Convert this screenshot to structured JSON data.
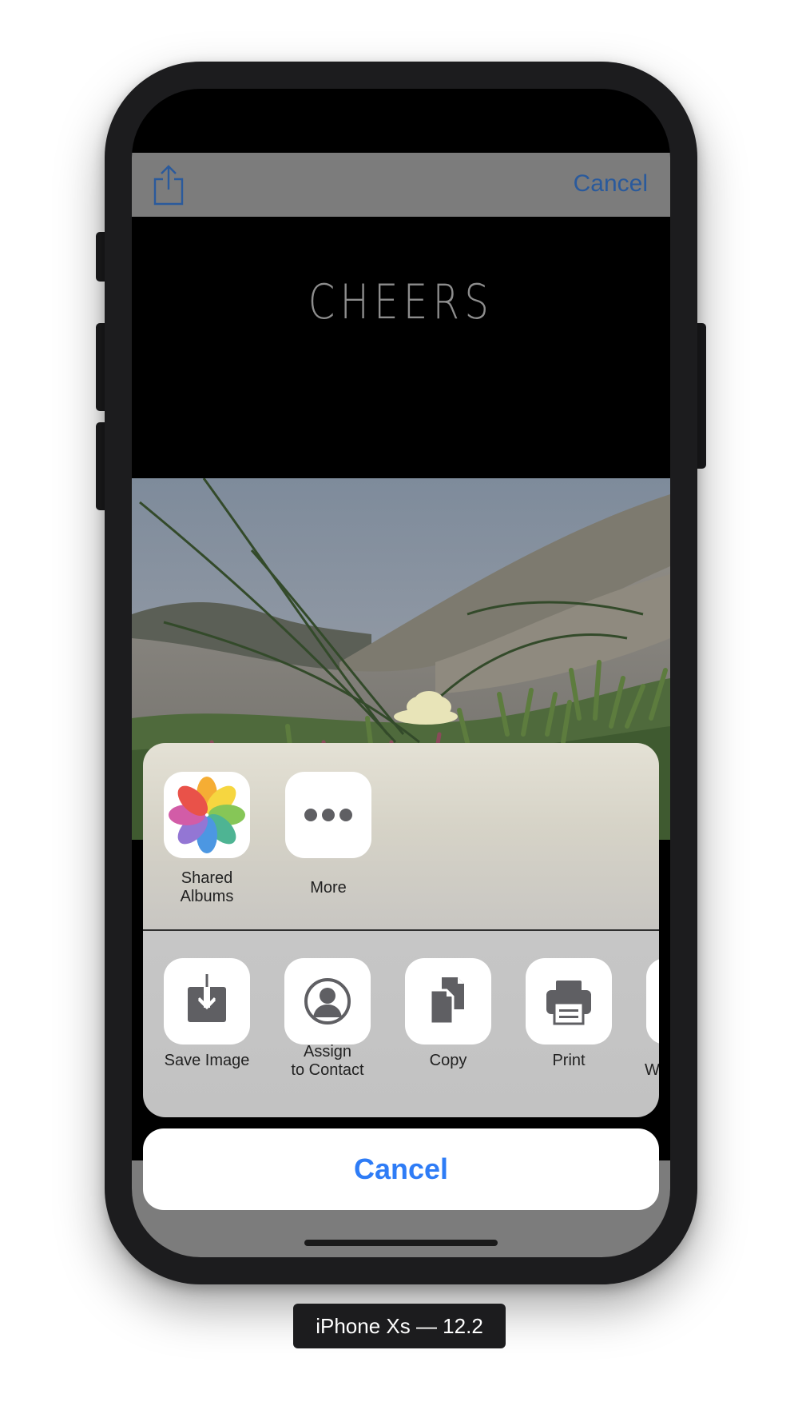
{
  "toolbar": {
    "share_icon": "share-icon",
    "cancel_label": "Cancel"
  },
  "content": {
    "title": "CHEERS"
  },
  "share_sheet": {
    "apps": [
      {
        "label": "Shared\nAlbums",
        "icon": "photos-icon"
      },
      {
        "label": "More",
        "icon": "more-icon"
      }
    ],
    "actions": [
      {
        "label": "Save Image",
        "icon": "save-image-icon"
      },
      {
        "label": "Assign\nto Contact",
        "icon": "assign-contact-icon"
      },
      {
        "label": "Copy",
        "icon": "copy-icon"
      },
      {
        "label": "Print",
        "icon": "print-icon"
      },
      {
        "label": "W",
        "icon": "partial-action-icon"
      }
    ],
    "cancel_label": "Cancel"
  },
  "device_label": "iPhone Xs — 12.2",
  "colors": {
    "accent": "#2e7cf6",
    "toolbar_link": "#2a5a9c",
    "icon_gray": "#5f5f63"
  }
}
